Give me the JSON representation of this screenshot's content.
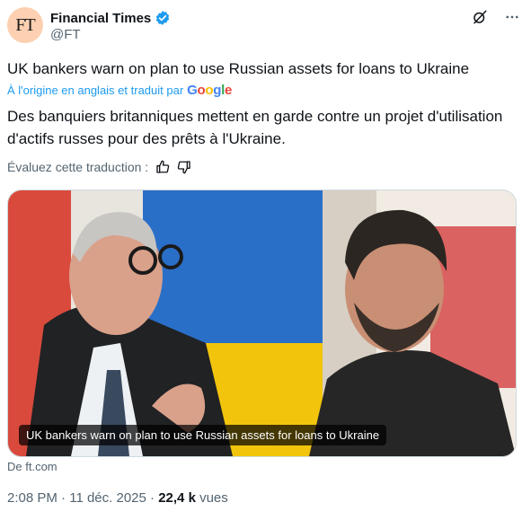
{
  "author": {
    "avatar_text": "FT",
    "display_name": "Financial Times",
    "handle": "@FT"
  },
  "tweet": {
    "original_text": "UK bankers warn on plan to use Russian assets for loans to Ukraine",
    "translated_label": "À l'origine en anglais et traduit par",
    "translator": "Google",
    "translated_text": "Des banquiers britanniques mettent en garde contre un projet d'utilisation d'actifs russes pour des prêts à l'Ukraine.",
    "rate_label": "Évaluez cette traduction :"
  },
  "card": {
    "caption": "UK bankers warn on plan to use Russian assets for loans to Ukraine",
    "source": "De ft.com"
  },
  "meta": {
    "time": "2:08 PM",
    "separator": "·",
    "date": "11 déc. 2025",
    "views_count": "22,4 k",
    "views_label": "vues"
  },
  "icons": [
    "verified-badge-icon",
    "grok-icon",
    "more-icon",
    "thumbs-up-icon",
    "thumbs-down-icon"
  ],
  "colors": {
    "accent": "#1d9bf0",
    "avatar_bg": "#fcd0b1",
    "muted": "#536471"
  }
}
